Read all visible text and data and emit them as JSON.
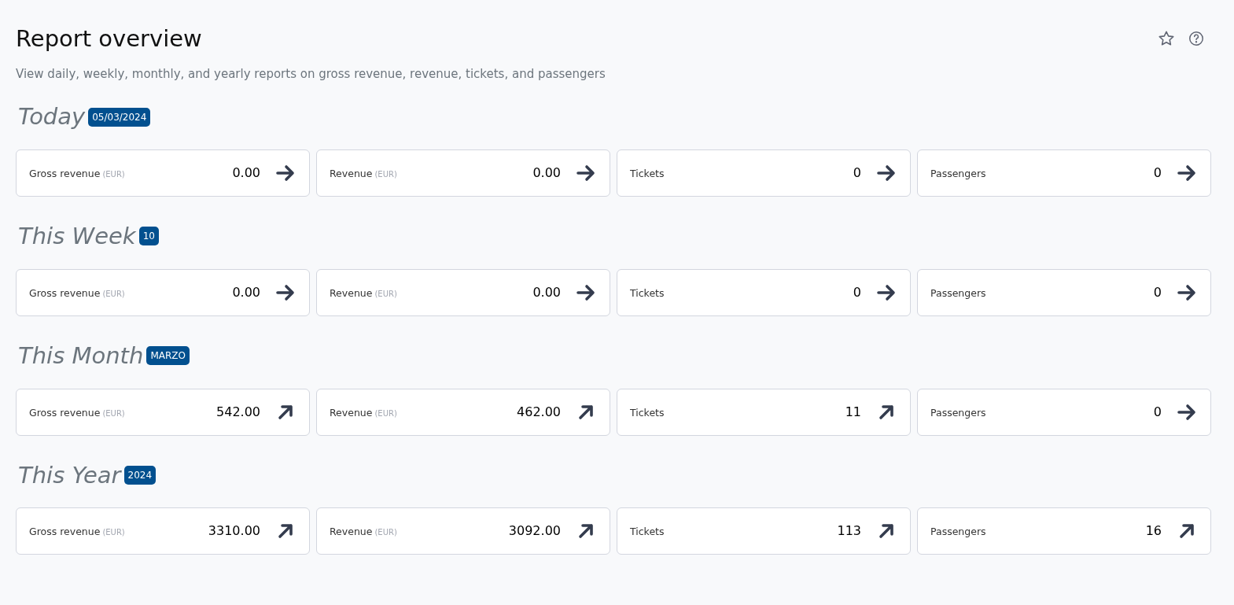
{
  "page": {
    "title": "Report overview",
    "subtitle": "View daily, weekly, monthly, and yearly reports on gross revenue, revenue, tickets, and passengers"
  },
  "sections": [
    {
      "heading": "Today",
      "badge": "05/03/2024",
      "cards": [
        {
          "label": "Gross revenue",
          "unit": "(EUR)",
          "value": "0.00",
          "kind": "flat"
        },
        {
          "label": "Revenue",
          "unit": "(EUR)",
          "value": "0.00",
          "kind": "flat"
        },
        {
          "label": "Tickets",
          "value": "0",
          "kind": "flat"
        },
        {
          "label": "Passengers",
          "value": "0",
          "kind": "flat"
        }
      ]
    },
    {
      "heading": "This Week",
      "badge": "10",
      "cards": [
        {
          "label": "Gross revenue",
          "unit": "(EUR)",
          "value": "0.00",
          "kind": "flat"
        },
        {
          "label": "Revenue",
          "unit": "(EUR)",
          "value": "0.00",
          "kind": "flat"
        },
        {
          "label": "Tickets",
          "value": "0",
          "kind": "flat"
        },
        {
          "label": "Passengers",
          "value": "0",
          "kind": "flat"
        }
      ]
    },
    {
      "heading": "This Month",
      "badge": "MARZO",
      "cards": [
        {
          "label": "Gross revenue",
          "unit": "(EUR)",
          "value": "542.00",
          "kind": "up"
        },
        {
          "label": "Revenue",
          "unit": "(EUR)",
          "value": "462.00",
          "kind": "up"
        },
        {
          "label": "Tickets",
          "value": "11",
          "kind": "up"
        },
        {
          "label": "Passengers",
          "value": "0",
          "kind": "flat"
        }
      ]
    },
    {
      "heading": "This Year",
      "badge": "2024",
      "cards": [
        {
          "label": "Gross revenue",
          "unit": "(EUR)",
          "value": "3310.00",
          "kind": "up"
        },
        {
          "label": "Revenue",
          "unit": "(EUR)",
          "value": "3092.00",
          "kind": "up"
        },
        {
          "label": "Tickets",
          "value": "113",
          "kind": "up"
        },
        {
          "label": "Passengers",
          "value": "16",
          "kind": "up"
        }
      ]
    }
  ]
}
